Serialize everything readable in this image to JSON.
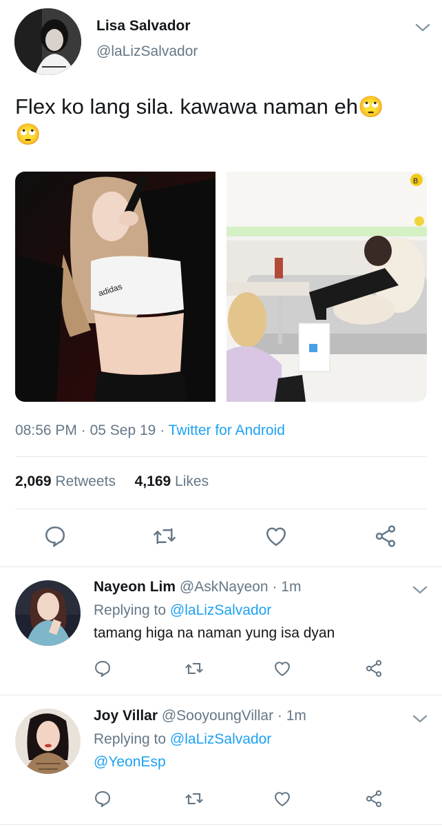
{
  "main_tweet": {
    "author_name": "Lisa Salvador",
    "author_handle": "@laLizSalvador",
    "text": "Flex ko lang sila. kawawa naman eh",
    "emoji_1": "🙄",
    "emoji_2": "🙄",
    "time": "08:56 PM",
    "sep1": "·",
    "date": "05 Sep 19",
    "sep2": "·",
    "source": "Twitter for Android",
    "retweet_count": "2,069",
    "retweet_label": "Retweets",
    "like_count": "4,169",
    "like_label": "Likes",
    "photo_1_logo": "adidas",
    "photo_2_badge": "B"
  },
  "replies": [
    {
      "name": "Nayeon Lim",
      "handle": "@AskNayeon",
      "time": "· 1m",
      "replying_prefix": "Replying to",
      "replying_to": "@laLizSalvador",
      "text": "tamang higa na naman yung isa dyan"
    },
    {
      "name": "Joy Villar",
      "handle": "@SooyoungVillar",
      "time": "· 1m",
      "replying_prefix": "Replying to",
      "replying_to": "@laLizSalvador",
      "text": "@YeonEsp"
    }
  ],
  "icons": {
    "reply": "reply-icon",
    "retweet": "retweet-icon",
    "like": "heart-icon",
    "share": "share-icon",
    "more": "chevron-down-icon"
  },
  "colors": {
    "link": "#1da1f2",
    "secondary_text": "#657786",
    "icon": "#657786",
    "divider": "#e1e8ed"
  }
}
